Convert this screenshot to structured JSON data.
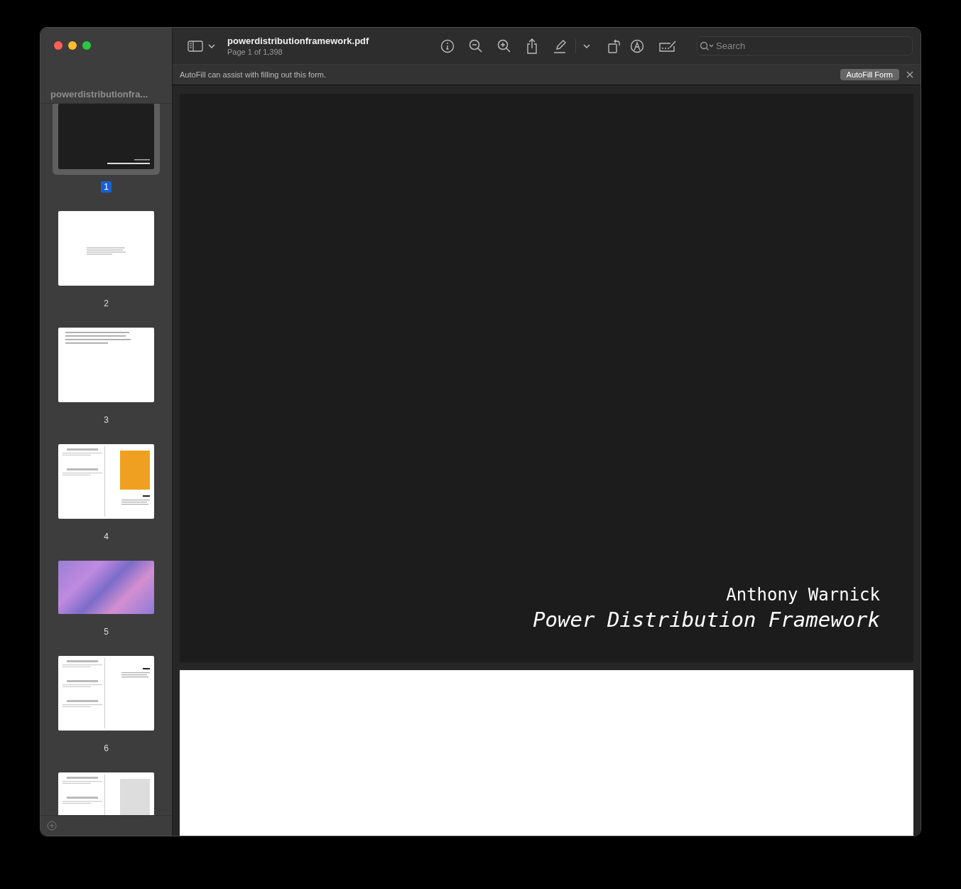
{
  "window": {
    "title": "powerdistributionframework.pdf",
    "subtitle": "Page 1 of 1,398"
  },
  "toolbar": {
    "search": {
      "placeholder": "Search"
    }
  },
  "autofill": {
    "message": "AutoFill can assist with filling out this form.",
    "button": "AutoFill Form"
  },
  "sidebar": {
    "title": "powerdistributionfra...",
    "thumbnails": [
      {
        "label": "1",
        "selected": true,
        "kind": "cover"
      },
      {
        "label": "2",
        "selected": false,
        "kind": "text"
      },
      {
        "label": "3",
        "selected": false,
        "kind": "text"
      },
      {
        "label": "4",
        "selected": false,
        "kind": "form-photo"
      },
      {
        "label": "5",
        "selected": false,
        "kind": "photo"
      },
      {
        "label": "6",
        "selected": false,
        "kind": "form"
      },
      {
        "selected": false,
        "kind": "form-photo"
      }
    ]
  },
  "document": {
    "pages": [
      {
        "kind": "cover",
        "author": "Anthony Warnick",
        "title": "Power Distribution Framework"
      },
      {
        "kind": "blank"
      }
    ]
  }
}
